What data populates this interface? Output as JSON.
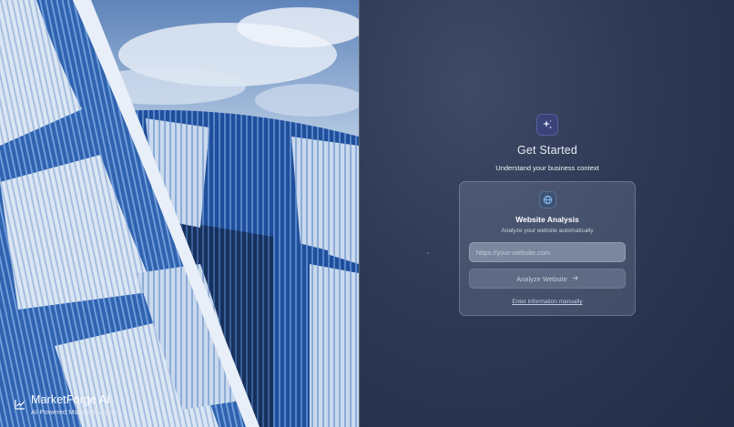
{
  "brand": {
    "name": "MarketForge AI",
    "tagline": "AI-Powered Market Analysis",
    "icon": "chart-icon"
  },
  "header": {
    "icon": "sparkles-icon",
    "title": "Get Started",
    "subtitle": "Understand your business context"
  },
  "card": {
    "icon": "globe-icon",
    "title": "Website Analysis",
    "subtitle": "Analyze your website automatically",
    "url_placeholder": "https://your-website.com",
    "url_value": "",
    "analyze_label": "Analyze Website",
    "analyze_icon": "arrow-right-icon",
    "manual_link": "Enter information manually"
  },
  "colors": {
    "accent": "#3a4378",
    "panel_bg": "#2e3a55",
    "card_bg": "#5f6b85"
  }
}
